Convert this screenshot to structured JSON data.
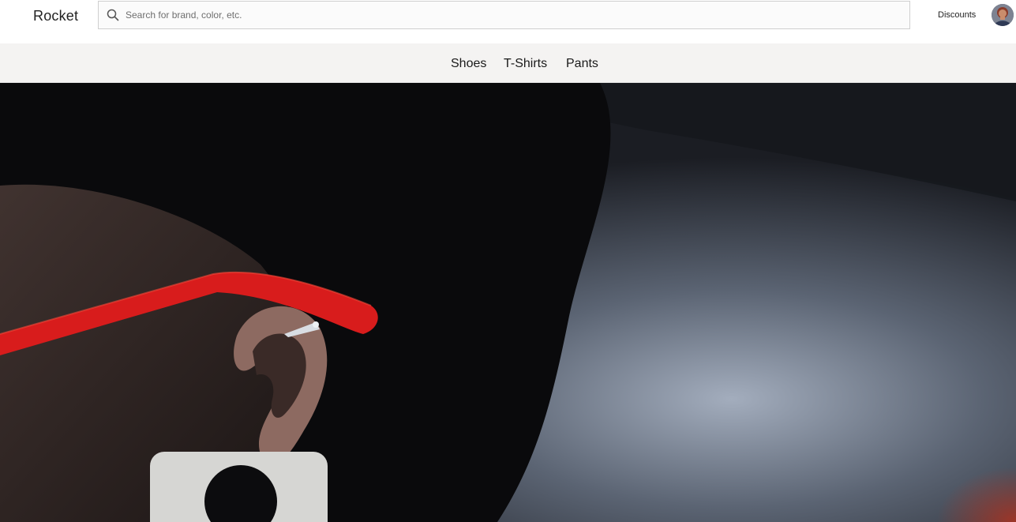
{
  "header": {
    "brand": "Rocket",
    "search": {
      "placeholder": "Search for brand, color, etc.",
      "value": "",
      "icon": "search-icon"
    },
    "discounts_label": "Discounts",
    "avatar_icon": "user-avatar"
  },
  "categories": [
    {
      "label": "Shoes"
    },
    {
      "label": "T-Shirts"
    },
    {
      "label": "Pants"
    }
  ],
  "hero": {
    "image": "person-with-red-sunglasses-and-ear-cuff",
    "colors": {
      "background": "#0d0e12",
      "glasses": "#d81c1c",
      "haze": "#8e98a8"
    }
  }
}
